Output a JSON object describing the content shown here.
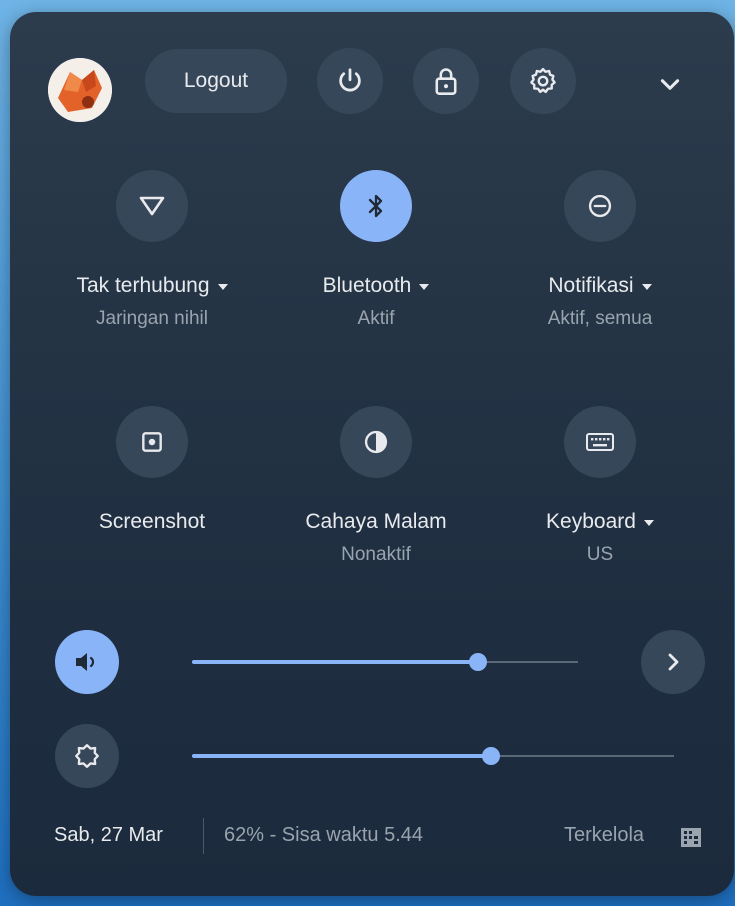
{
  "header": {
    "logout_label": "Logout"
  },
  "tiles": [
    {
      "label": "Tak terhubung",
      "sub": "Jaringan nihil",
      "icon": "wifi-off-icon",
      "has_menu": true,
      "active": false
    },
    {
      "label": "Bluetooth",
      "sub": "Aktif",
      "icon": "bluetooth-icon",
      "has_menu": true,
      "active": true
    },
    {
      "label": "Notifikasi",
      "sub": "Aktif, semua",
      "icon": "do-not-disturb-icon",
      "has_menu": true,
      "active": false
    },
    {
      "label": "Screenshot",
      "sub": "",
      "icon": "screenshot-icon",
      "has_menu": false,
      "active": false
    },
    {
      "label": "Cahaya Malam",
      "sub": "Nonaktif",
      "icon": "night-light-icon",
      "has_menu": false,
      "active": false
    },
    {
      "label": "Keyboard",
      "sub": "US",
      "icon": "keyboard-icon",
      "has_menu": true,
      "active": false
    }
  ],
  "sliders": {
    "volume": {
      "level": 0.74
    },
    "brightness": {
      "level": 0.62
    }
  },
  "footer": {
    "date": "Sab, 27 Mar",
    "battery": "62% - Sisa waktu 5.44",
    "managed": "Terkelola"
  },
  "colors": {
    "panel_bg": "#243445",
    "button_bg": "#37475a",
    "accent": "#8ab4f8",
    "text_primary": "#e8eaed",
    "text_secondary": "#9aa4ae"
  }
}
